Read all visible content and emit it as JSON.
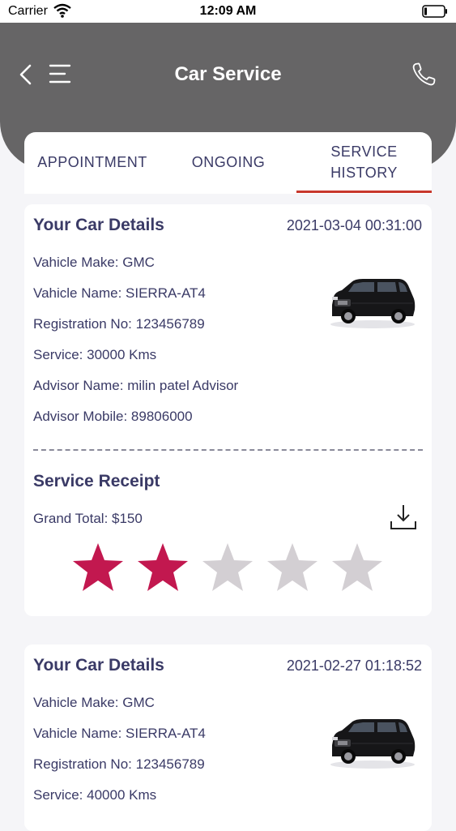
{
  "status_bar": {
    "carrier": "Carrier",
    "time": "12:09 AM"
  },
  "header": {
    "title": "Car Service"
  },
  "tabs": [
    {
      "label": "APPOINTMENT",
      "selected": false
    },
    {
      "label": "ONGOING",
      "selected": false
    },
    {
      "label": "SERVICE HISTORY",
      "selected": true
    }
  ],
  "colors": {
    "header_bg": "#666566",
    "accent": "#c8372c",
    "star_filled": "#c2184f",
    "star_empty": "#d3cfd3",
    "text": "#3a3a66"
  },
  "records": [
    {
      "title": "Your Car Details",
      "date": "2021-03-04 00:31:00",
      "make": "Vahicle Make: GMC",
      "name": "Vahicle Name: SIERRA-AT4",
      "registration": "Registration No: 123456789",
      "service": "Service: 30000 Kms",
      "advisor_name": "Advisor Name: milin patel Advisor",
      "advisor_mobile": "Advisor Mobile: 89806000",
      "receipt_title": "Service Receipt",
      "grand_total": "Grand Total: $150",
      "rating": 2,
      "rating_max": 5
    },
    {
      "title": "Your Car Details",
      "date": "2021-02-27 01:18:52",
      "make": "Vahicle Make: GMC",
      "name": "Vahicle Name: SIERRA-AT4",
      "registration": "Registration No: 123456789",
      "service": "Service: 40000 Kms"
    }
  ]
}
